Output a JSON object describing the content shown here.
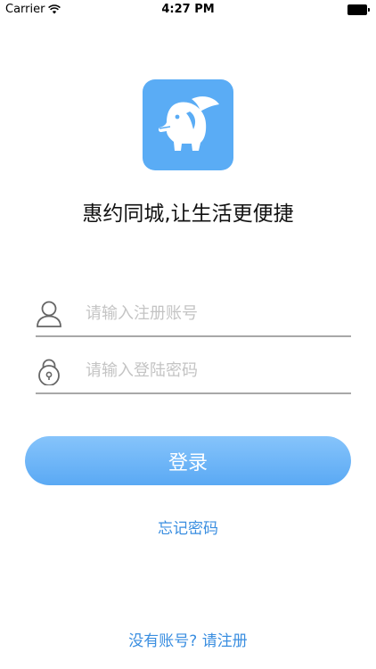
{
  "status_bar": {
    "carrier": "Carrier",
    "time": "4:27 PM",
    "icons": [
      "wifi-icon",
      "battery-icon"
    ]
  },
  "app": {
    "logo_icon": "elephant-icon",
    "brand_color": "#5aacf5",
    "slogan": "惠约同城,让生活更便捷"
  },
  "login_form": {
    "username": {
      "icon": "user-icon",
      "placeholder": "请输入注册账号",
      "value": ""
    },
    "password": {
      "icon": "lock-icon",
      "placeholder": "请输入登陆密码",
      "value": ""
    },
    "login_label": "登录"
  },
  "links": {
    "forgot_password": "忘记密码",
    "register": "没有账号? 请注册",
    "link_color": "#3a8ee0"
  }
}
